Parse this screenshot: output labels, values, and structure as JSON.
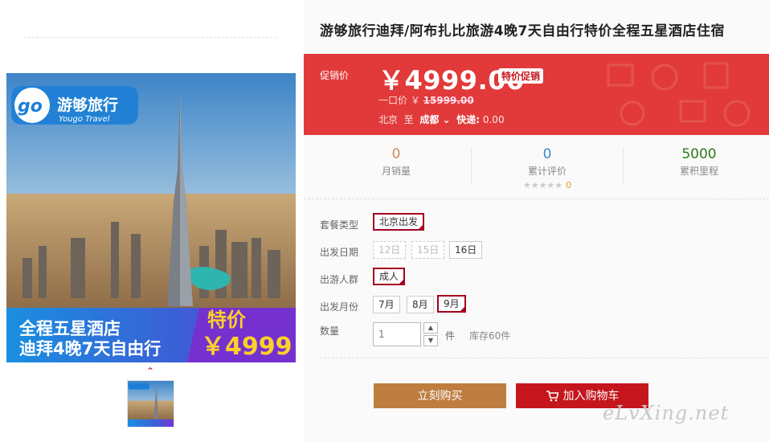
{
  "product": {
    "title": "游够旅行迪拜/阿布扎比旅游4晚7天自由行特价全程五星酒店住宿"
  },
  "gallery": {
    "brand_logo": "go",
    "brand_cn": "游够旅行",
    "brand_en": "Yougo Travel",
    "banner_line1": "全程五星酒店",
    "banner_line2": "迪拜4晚7天自由行",
    "promo_label": "特价",
    "promo_price": "￥4999",
    "prev_arrow": "⌃"
  },
  "price": {
    "label": "促销价",
    "value": "￥4999.00",
    "badge": "特价促销",
    "orig_label": "一口价 ￥",
    "orig_value": "15999.00",
    "from": "北京",
    "to_word": "至",
    "destination": "成都",
    "shipping_label": "快递:",
    "shipping_value": "0.00"
  },
  "stats": [
    {
      "num": "0",
      "label": "月销量"
    },
    {
      "num": "0",
      "label": "累计评价",
      "stars": "★★★★★",
      "review_count": "0"
    },
    {
      "num": "5000",
      "label": "累积里程"
    }
  ],
  "options": {
    "package_label": "套餐类型",
    "package_value": "北京出发",
    "date_label": "出发日期",
    "dates": [
      "12日",
      "15日",
      "16日"
    ],
    "crowd_label": "出游人群",
    "crowd_value": "成人",
    "month_label": "出发月份",
    "months": [
      "7月",
      "8月",
      "9月"
    ],
    "qty_label": "数量",
    "qty_value": "1",
    "qty_unit": "件",
    "stock": "库存60件"
  },
  "actions": {
    "buy": "立刻购买",
    "cart": "加入购物车"
  },
  "watermark": "eLvXing.net",
  "colors": {
    "price_bg": "#e23a3a",
    "buy_btn": "#bf7d40",
    "cart_btn": "#c4161c",
    "selected_border": "#a3001e"
  }
}
